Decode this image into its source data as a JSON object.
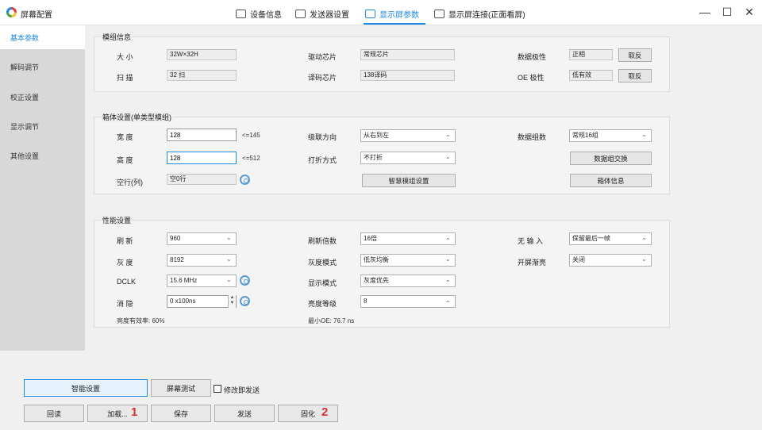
{
  "window": {
    "title": "屏幕配置",
    "tabs": [
      {
        "label": "设备信息",
        "icon": "device-info-icon"
      },
      {
        "label": "发送器设置",
        "icon": "sender-icon"
      },
      {
        "label": "显示屏参数",
        "icon": "display-params-icon",
        "active": true
      },
      {
        "label": "显示屏连接(正面看屏)",
        "icon": "connection-icon"
      }
    ],
    "accent": "#1e88e5"
  },
  "sidebar": {
    "items": [
      {
        "label": "基本参数",
        "active": true
      },
      {
        "label": "解码调节"
      },
      {
        "label": "校正设置"
      },
      {
        "label": "显示调节"
      },
      {
        "label": "其他设置"
      }
    ]
  },
  "module_info": {
    "title": "模组信息",
    "size_label": "大  小",
    "size_value": "32W×32H",
    "scan_label": "扫  描",
    "scan_value": "32 扫",
    "driver_label": "驱动芯片",
    "driver_value": "常规芯片",
    "decoder_label": "译码芯片",
    "decoder_value": "138译码",
    "data_polarity_label": "数据极性",
    "data_polarity_value": "正相",
    "oe_polarity_label": "OE 极性",
    "oe_polarity_value": "低有效",
    "invert_label": "取反"
  },
  "cabinet": {
    "title": "箱体设置(单类型模组)",
    "width_label": "宽  度",
    "width_value": "128",
    "width_limit": "<=145",
    "height_label": "高  度",
    "height_value": "128",
    "height_limit": "<=512",
    "empty_row_label": "空行(列)",
    "empty_row_value": "空0行",
    "cascade_label": "级联方向",
    "cascade_value": "从右到左",
    "fold_label": "打折方式",
    "fold_value": "不打折",
    "smart_module_btn": "智慧模组设置",
    "data_groups_label": "数据组数",
    "data_groups_value": "常规16组",
    "swap_btn": "数据组交换",
    "cabinet_info_btn": "箱体信息"
  },
  "performance": {
    "title": "性能设置",
    "refresh_label": "刷  新",
    "refresh_value": "960",
    "gray_label": "灰  度",
    "gray_value": "8192",
    "dclk_label": "DCLK",
    "dclk_value": "15.6 MHz",
    "blank_label": "消  隐",
    "blank_value": "0 x100ns",
    "efficiency_text": "亮度有效率: 60%",
    "refresh_mult_label": "刷新倍数",
    "refresh_mult_value": "16倍",
    "gray_mode_label": "灰度模式",
    "gray_mode_value": "低灰均衡",
    "display_mode_label": "显示模式",
    "display_mode_value": "灰度优先",
    "brightness_label": "亮度等级",
    "brightness_value": "8",
    "min_oe_text": "最小OE: 76.7 ns",
    "no_input_label": "无  输  入",
    "no_input_value": "保留最后一帧",
    "fade_label": "开屏渐亮",
    "fade_value": "关闭"
  },
  "bottom": {
    "smart_setup": "智能设置",
    "screen_test": "屏幕测试",
    "send_on_modify": "修改即发送",
    "readback": "回读",
    "load": "加载...",
    "save": "保存",
    "send": "发送",
    "solidify": "固化",
    "mark1": "1",
    "mark2": "2"
  }
}
